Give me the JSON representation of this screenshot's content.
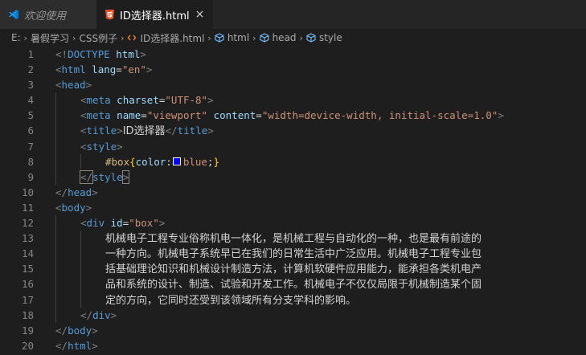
{
  "tabs": [
    {
      "label": "欢迎使用",
      "icon": "vscode-icon",
      "active": false
    },
    {
      "label": "ID选择器.html",
      "icon": "html5-icon",
      "active": true,
      "close": "×"
    }
  ],
  "breadcrumb": {
    "items": [
      "E:",
      "暑假学习",
      "CSS例子",
      "ID选择器.html",
      "html",
      "head",
      "style"
    ],
    "separator": "›"
  },
  "colors": {
    "background": "#1e1e1e",
    "tag": "#569cd6",
    "attribute": "#9cdcfe",
    "string": "#ce9178",
    "selector": "#d7ba7d",
    "swatch_blue": "#0000ff"
  },
  "lines": [
    {
      "n": "1",
      "indent": 0,
      "tokens": [
        [
          "punct",
          "<!"
        ],
        [
          "tag",
          "DOCTYPE"
        ],
        [
          "attr",
          " html"
        ],
        [
          "punct",
          ">"
        ]
      ]
    },
    {
      "n": "2",
      "indent": 0,
      "tokens": [
        [
          "punct",
          "<"
        ],
        [
          "tag",
          "html"
        ],
        [
          "attr",
          " lang"
        ],
        [
          "text",
          "="
        ],
        [
          "str",
          "\"en\""
        ],
        [
          "punct",
          ">"
        ]
      ]
    },
    {
      "n": "3",
      "indent": 0,
      "tokens": [
        [
          "punct",
          "<"
        ],
        [
          "tag",
          "head"
        ],
        [
          "punct",
          ">"
        ]
      ]
    },
    {
      "n": "4",
      "indent": 1,
      "tokens": [
        [
          "punct",
          "<"
        ],
        [
          "tag",
          "meta"
        ],
        [
          "attr",
          " charset"
        ],
        [
          "text",
          "="
        ],
        [
          "str",
          "\"UTF-8\""
        ],
        [
          "punct",
          ">"
        ]
      ]
    },
    {
      "n": "5",
      "indent": 1,
      "tokens": [
        [
          "punct",
          "<"
        ],
        [
          "tag",
          "meta"
        ],
        [
          "attr",
          " name"
        ],
        [
          "text",
          "="
        ],
        [
          "str",
          "\"viewport\""
        ],
        [
          "attr",
          " content"
        ],
        [
          "text",
          "="
        ],
        [
          "str",
          "\"width=device-width, initial-scale=1.0\""
        ],
        [
          "punct",
          ">"
        ]
      ]
    },
    {
      "n": "6",
      "indent": 1,
      "tokens": [
        [
          "punct",
          "<"
        ],
        [
          "tag",
          "title"
        ],
        [
          "punct",
          ">"
        ],
        [
          "cjk",
          "ID选择器"
        ],
        [
          "punct",
          "</"
        ],
        [
          "tag",
          "title"
        ],
        [
          "punct",
          ">"
        ]
      ]
    },
    {
      "n": "7",
      "indent": 1,
      "tokens": [
        [
          "punct",
          "<"
        ],
        [
          "tag",
          "style"
        ],
        [
          "punct",
          ">"
        ]
      ]
    },
    {
      "n": "8",
      "indent": 2,
      "tokens": [
        [
          "sel",
          "#box"
        ],
        [
          "brace",
          "{"
        ],
        [
          "prop",
          "color"
        ],
        [
          "text",
          ":"
        ],
        [
          "swatch",
          ""
        ],
        [
          "val",
          "blue"
        ],
        [
          "text",
          ";"
        ],
        [
          "brace",
          "}"
        ]
      ]
    },
    {
      "n": "9",
      "indent": 1,
      "tokens": [
        [
          "punctm",
          "</"
        ],
        [
          "tag",
          "style"
        ],
        [
          "punctm",
          ">"
        ]
      ]
    },
    {
      "n": "10",
      "indent": 0,
      "tokens": [
        [
          "punct",
          "</"
        ],
        [
          "tag",
          "head"
        ],
        [
          "punct",
          ">"
        ]
      ]
    },
    {
      "n": "11",
      "indent": 0,
      "tokens": [
        [
          "punct",
          "<"
        ],
        [
          "tag",
          "body"
        ],
        [
          "punct",
          ">"
        ]
      ]
    },
    {
      "n": "12",
      "indent": 1,
      "tokens": [
        [
          "punct",
          "<"
        ],
        [
          "tag",
          "div"
        ],
        [
          "attr",
          " id"
        ],
        [
          "text",
          "="
        ],
        [
          "str",
          "\"box\""
        ],
        [
          "punct",
          ">"
        ]
      ]
    },
    {
      "n": "13",
      "indent": 2,
      "tokens": [
        [
          "cjk",
          "机械电子工程专业俗称机电一体化，是机械工程与自动化的一种，也是最有前途的"
        ]
      ]
    },
    {
      "n": "14",
      "indent": 2,
      "tokens": [
        [
          "cjk",
          "一种方向。机械电子系统早已在我们的日常生活中广泛应用。机械电子工程专业包"
        ]
      ]
    },
    {
      "n": "15",
      "indent": 2,
      "tokens": [
        [
          "cjk",
          "括基础理论知识和机械设计制造方法，计算机软硬件应用能力，能承担各类机电产"
        ]
      ]
    },
    {
      "n": "16",
      "indent": 2,
      "tokens": [
        [
          "cjk",
          "品和系统的设计、制造、试验和开发工作。机械电子不仅仅局限于机械制造某个固"
        ]
      ]
    },
    {
      "n": "17",
      "indent": 2,
      "tokens": [
        [
          "cjk",
          "定的方向，它同时还受到该领域所有分支学科的影响。"
        ]
      ]
    },
    {
      "n": "18",
      "indent": 1,
      "tokens": [
        [
          "punct",
          "</"
        ],
        [
          "tag",
          "div"
        ],
        [
          "punct",
          ">"
        ]
      ]
    },
    {
      "n": "19",
      "indent": 0,
      "tokens": [
        [
          "punct",
          "</"
        ],
        [
          "tag",
          "body"
        ],
        [
          "punct",
          ">"
        ]
      ]
    },
    {
      "n": "20",
      "indent": 0,
      "tokens": [
        [
          "punct",
          "</"
        ],
        [
          "tag",
          "html"
        ],
        [
          "punct",
          ">"
        ]
      ]
    }
  ]
}
